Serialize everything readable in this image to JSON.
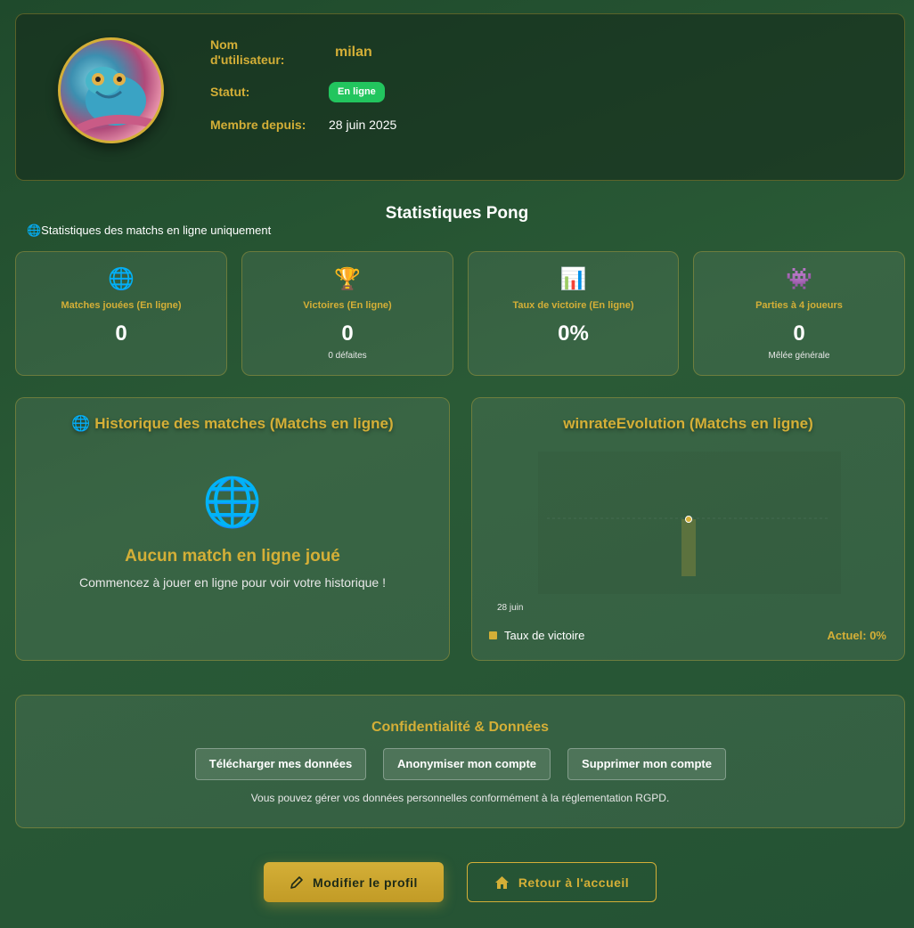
{
  "profile": {
    "username_label": "Nom d'utilisateur:",
    "username": "milan",
    "status_label": "Statut:",
    "status": "En ligne",
    "member_label": "Membre depuis:",
    "member_since": "28 juin 2025"
  },
  "stats_title": "Statistiques Pong",
  "online_note": "🌐Statistiques des matchs en ligne uniquement",
  "stats": [
    {
      "icon": "🌐",
      "label": "Matches jouées (En ligne)",
      "value": "0",
      "sub": ""
    },
    {
      "icon": "🏆",
      "label": "Victoires (En ligne)",
      "value": "0",
      "sub": "0 défaites"
    },
    {
      "icon": "📊",
      "label": "Taux de victoire (En ligne)",
      "value": "0%",
      "sub": ""
    },
    {
      "icon": "👾",
      "label": "Parties à 4 joueurs",
      "value": "0",
      "sub": "Mêlée générale"
    }
  ],
  "history": {
    "title": "🌐 Historique des matches (Matchs en ligne)",
    "empty_icon": "🌐",
    "empty_title": "Aucun match en ligne joué",
    "empty_sub": "Commencez à jouer en ligne pour voir votre historique !"
  },
  "winrate": {
    "title": "winrateEvolution (Matchs en ligne)",
    "legend": "Taux de victoire",
    "current": "Actuel: 0%",
    "accent": "#d4af37"
  },
  "chart_data": {
    "type": "line",
    "x": [
      "28 juin"
    ],
    "series": [
      {
        "name": "Taux de victoire",
        "values": [
          0
        ]
      }
    ]
  },
  "privacy": {
    "title": "Confidentialité & Données",
    "download": "Télécharger mes données",
    "anonymize": "Anonymiser mon compte",
    "delete": "Supprimer mon compte",
    "note": "Vous pouvez gérer vos données personnelles conformément à la réglementation RGPD."
  },
  "actions": {
    "edit": "Modifier le profil",
    "home": "Retour à l'accueil"
  }
}
